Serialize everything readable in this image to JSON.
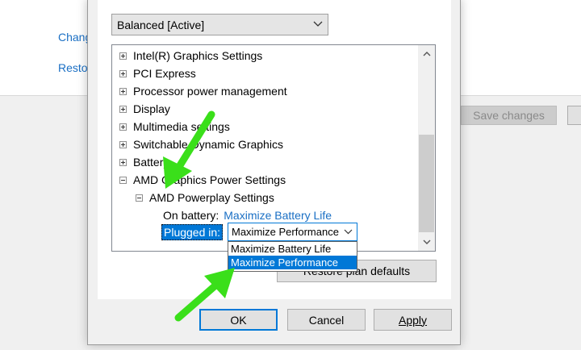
{
  "background": {
    "link_1": "Chang",
    "link_2": "Resto",
    "save_changes": "Save changes"
  },
  "plan_select": {
    "value": "Balanced [Active]"
  },
  "tree": {
    "items": [
      {
        "label": "Intel(R) Graphics Settings",
        "expanded": false
      },
      {
        "label": "PCI Express",
        "expanded": false
      },
      {
        "label": "Processor power management",
        "expanded": false
      },
      {
        "label": "Display",
        "expanded": false
      },
      {
        "label": "Multimedia settings",
        "expanded": false
      },
      {
        "label": "Switchable Dynamic Graphics",
        "expanded": false
      },
      {
        "label": "Battery",
        "expanded": false
      },
      {
        "label": "AMD Graphics Power Settings",
        "expanded": true
      },
      {
        "label": "AMD Powerplay Settings",
        "expanded": true
      }
    ],
    "on_battery_label": "On battery:",
    "on_battery_value": "Maximize Battery Life",
    "plugged_in_label": "Plugged in:"
  },
  "combo": {
    "value": "Maximize Performance",
    "options": [
      "Maximize Battery Life",
      "Maximize Performance"
    ],
    "selected_index": 1
  },
  "restore_button": "Restore plan defaults",
  "buttons": {
    "ok": "OK",
    "cancel": "Cancel",
    "apply": "Apply"
  },
  "colors": {
    "accent": "#0078d7",
    "link": "#1a6fc4",
    "arrow": "#3adf1a"
  },
  "icons": [
    "chevron-down-icon",
    "scroll-up-icon",
    "scroll-down-icon",
    "expand-icon",
    "collapse-icon",
    "green-arrow-icon"
  ]
}
